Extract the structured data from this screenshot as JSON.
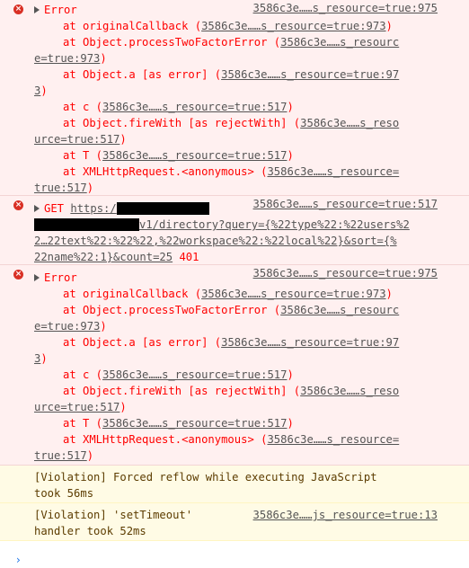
{
  "messages": [
    {
      "type": "error",
      "title": "Error",
      "source": "3586c3e……s_resource=true:975",
      "stack": [
        {
          "pre": "at originalCallback (",
          "link": "3586c3e……s_resource=true:973",
          "post": ")"
        },
        {
          "pre": "at Object.processTwoFactorError (",
          "link": "3586c3e……s_resourc",
          "post": ""
        },
        {
          "pre": "",
          "link": "e=true:973",
          "post": ")"
        },
        {
          "pre": "at Object.a [as error] (",
          "link": "3586c3e……s_resource=true:97",
          "post": ""
        },
        {
          "pre": "",
          "link": "3",
          "post": ")"
        },
        {
          "pre": "at c (",
          "link": "3586c3e……s_resource=true:517",
          "post": ")"
        },
        {
          "pre": "at Object.fireWith [as rejectWith] (",
          "link": "3586c3e……s_reso",
          "post": ""
        },
        {
          "pre": "",
          "link": "urce=true:517",
          "post": ")"
        },
        {
          "pre": "at T (",
          "link": "3586c3e……s_resource=true:517",
          "post": ")"
        },
        {
          "pre": "at XMLHttpRequest.<anonymous> (",
          "link": "3586c3e……s_resource=",
          "post": ""
        },
        {
          "pre": "",
          "link": "true:517",
          "post": ")"
        }
      ]
    },
    {
      "type": "error",
      "method": "GET",
      "url_start": "https:/",
      "source": "3586c3e……s_resource=true:517",
      "url_line2": "v1/directory?query={%22type%22:%22users%2",
      "url_line3": "2…22text%22:%22%22,%22workspace%22:%22local%22}&sort={%",
      "url_line4": "22name%22:1}&count=25",
      "status": "401"
    },
    {
      "type": "error",
      "title": "Error",
      "source": "3586c3e……s_resource=true:975",
      "stack": [
        {
          "pre": "at originalCallback (",
          "link": "3586c3e……s_resource=true:973",
          "post": ")"
        },
        {
          "pre": "at Object.processTwoFactorError (",
          "link": "3586c3e……s_resourc",
          "post": ""
        },
        {
          "pre": "",
          "link": "e=true:973",
          "post": ")"
        },
        {
          "pre": "at Object.a [as error] (",
          "link": "3586c3e……s_resource=true:97",
          "post": ""
        },
        {
          "pre": "",
          "link": "3",
          "post": ")"
        },
        {
          "pre": "at c (",
          "link": "3586c3e……s_resource=true:517",
          "post": ")"
        },
        {
          "pre": "at Object.fireWith [as rejectWith] (",
          "link": "3586c3e……s_reso",
          "post": ""
        },
        {
          "pre": "",
          "link": "urce=true:517",
          "post": ")"
        },
        {
          "pre": "at T (",
          "link": "3586c3e……s_resource=true:517",
          "post": ")"
        },
        {
          "pre": "at XMLHttpRequest.<anonymous> (",
          "link": "3586c3e……s_resource=",
          "post": ""
        },
        {
          "pre": "",
          "link": "true:517",
          "post": ")"
        }
      ]
    },
    {
      "type": "warning",
      "line1": "[Violation] Forced reflow while executing JavaScript",
      "line2": "took 56ms"
    },
    {
      "type": "warning",
      "line1": "[Violation] 'setTimeout'",
      "source": "3586c3e……js_resource=true:13",
      "line2": "handler took 52ms"
    }
  ],
  "prompt_symbol": "›"
}
